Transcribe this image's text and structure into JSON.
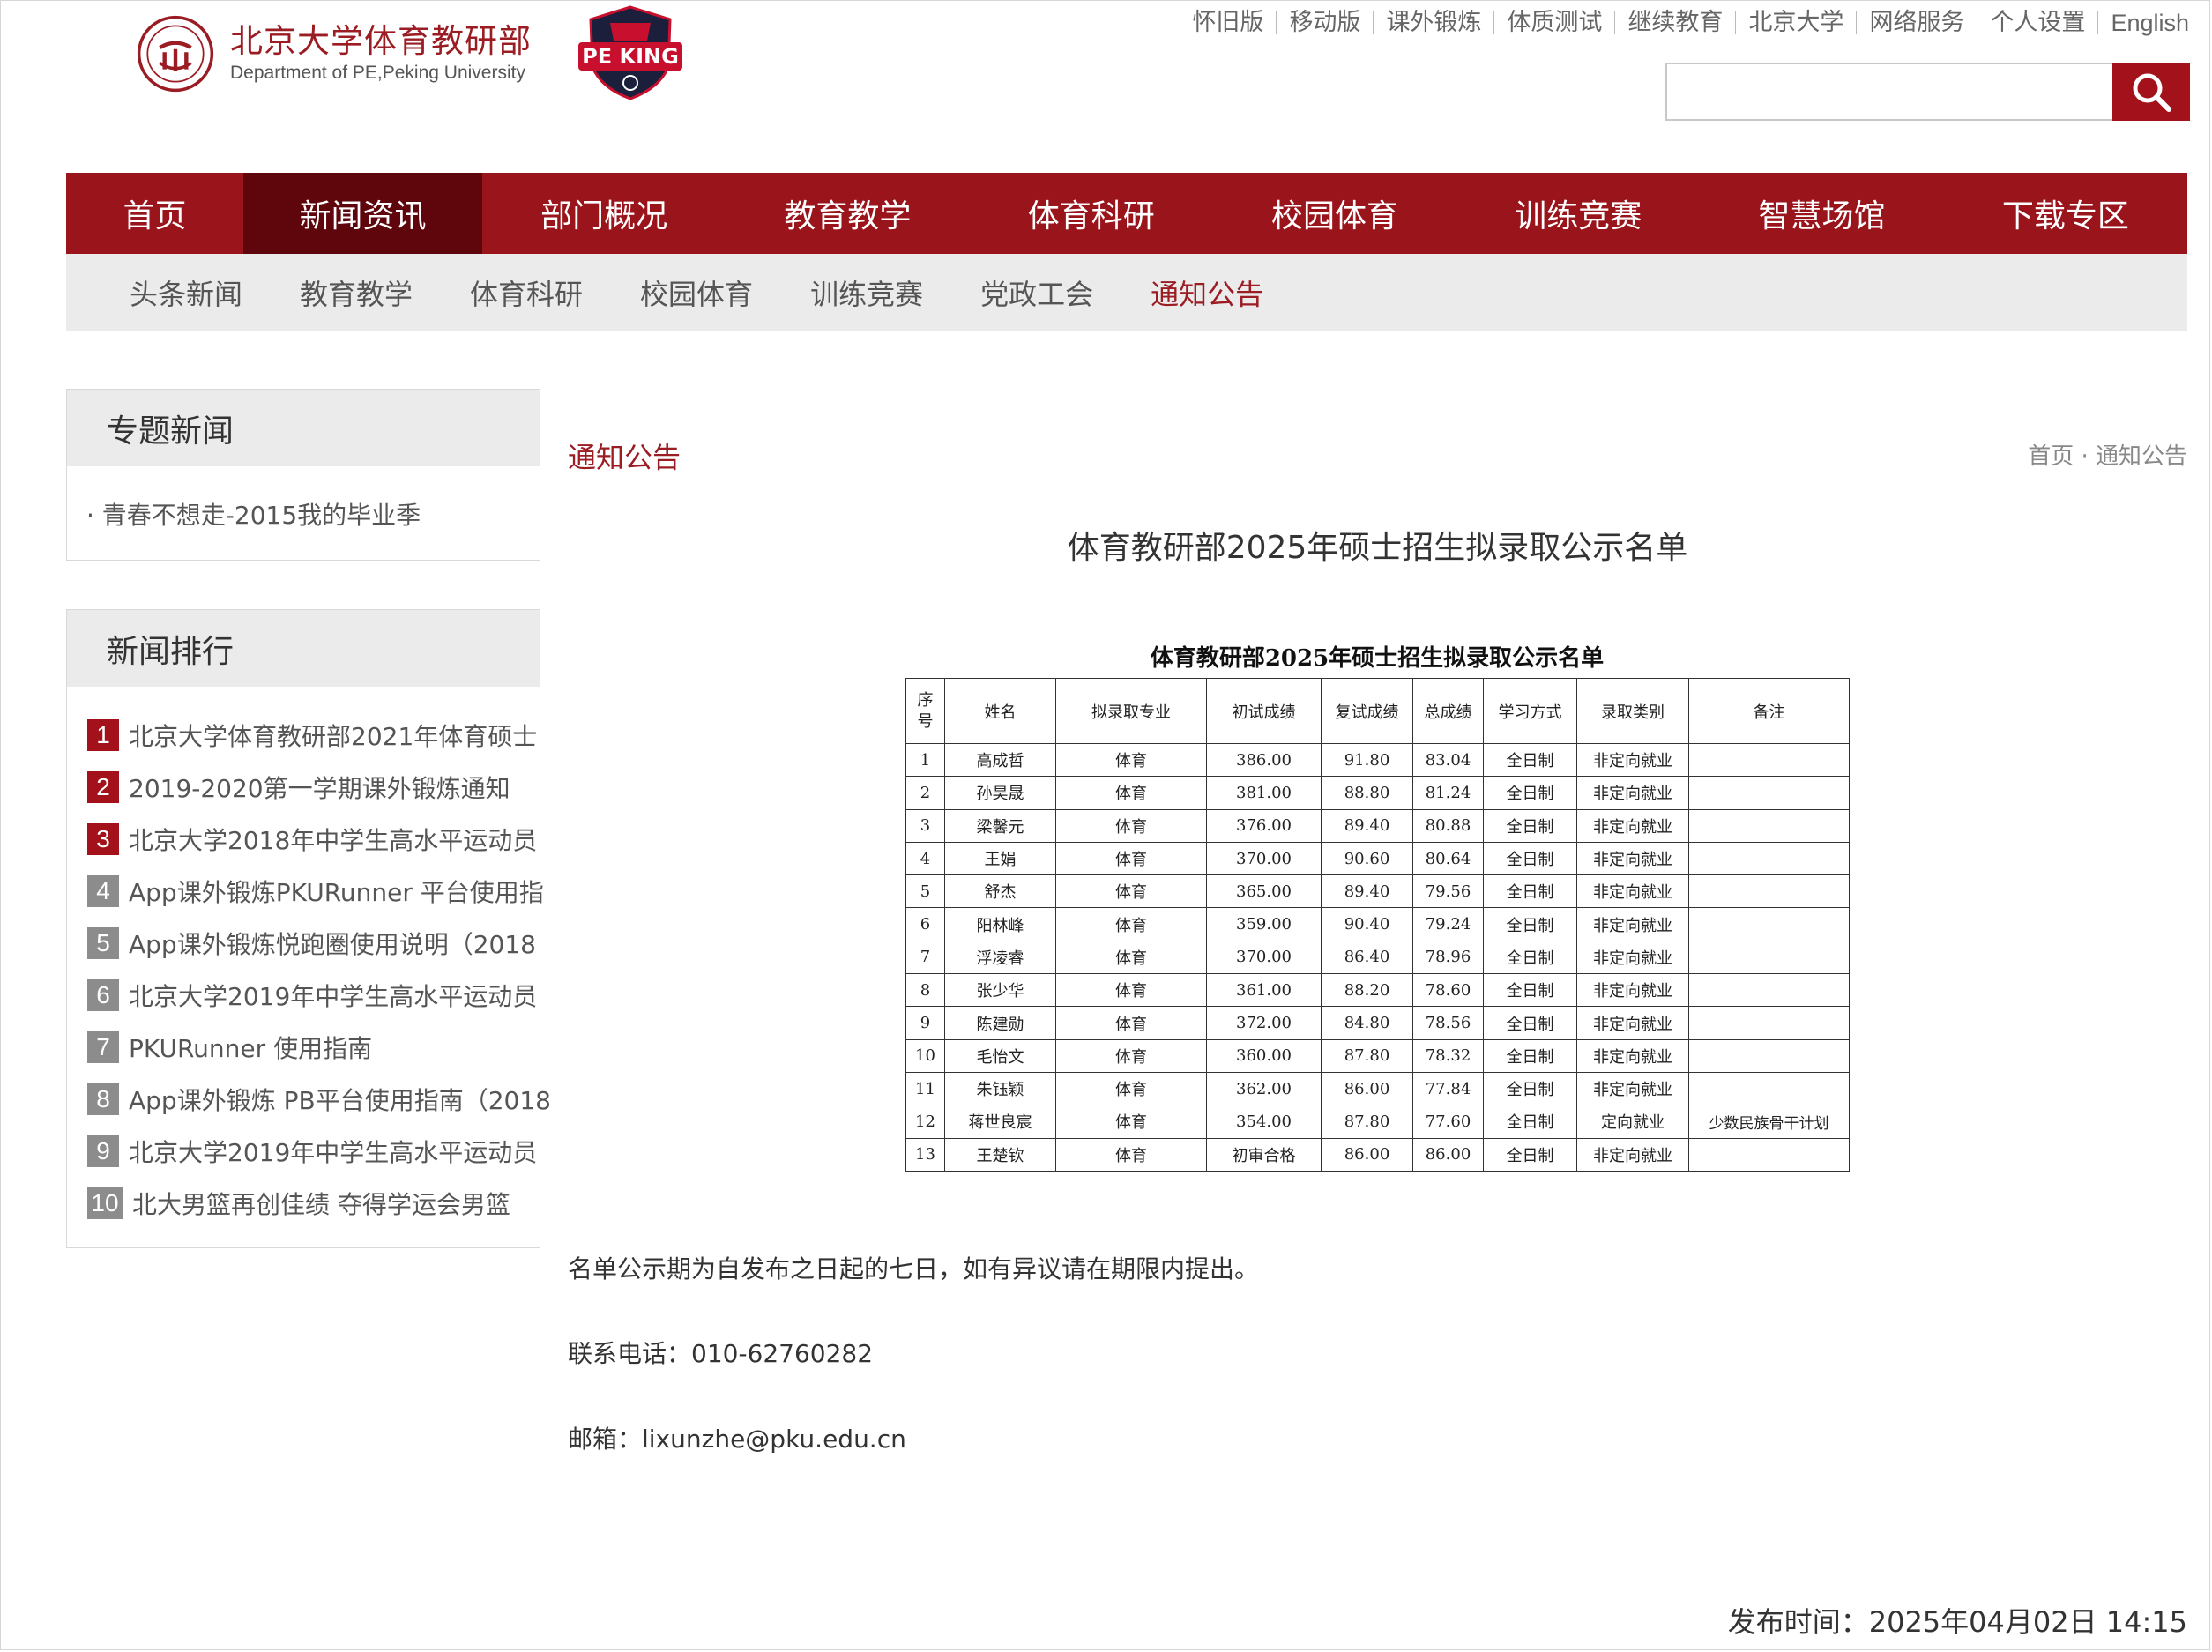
{
  "header": {
    "logo_cn": "北京大学体育教研部",
    "logo_en": "Department of PE,Peking University",
    "badge_text": "PE KING",
    "top_links": [
      "怀旧版",
      "移动版",
      "课外锻炼",
      "体质测试",
      "继续教育",
      "北京大学",
      "网络服务",
      "个人设置",
      "English"
    ],
    "search_placeholder": ""
  },
  "nav": {
    "items": [
      "首页",
      "新闻资讯",
      "部门概况",
      "教育教学",
      "体育科研",
      "校园体育",
      "训练竞赛",
      "智慧场馆",
      "下载专区"
    ],
    "active": "新闻资讯"
  },
  "subnav": {
    "items": [
      "头条新闻",
      "教育教学",
      "体育科研",
      "校园体育",
      "训练竞赛",
      "党政工会",
      "通知公告"
    ],
    "active": "通知公告"
  },
  "sidebar": {
    "special": {
      "title": "专题新闻",
      "item": "· 青春不想走-2015我的毕业季"
    },
    "ranking": {
      "title": "新闻排行",
      "items": [
        {
          "num": "1",
          "text": "北京大学体育教研部2021年体育硕士"
        },
        {
          "num": "2",
          "text": "2019-2020第一学期课外锻炼通知"
        },
        {
          "num": "3",
          "text": "北京大学2018年中学生高水平运动员"
        },
        {
          "num": "4",
          "text": "App课外锻炼PKURunner 平台使用指"
        },
        {
          "num": "5",
          "text": "App课外锻炼悦跑圈使用说明（2018"
        },
        {
          "num": "6",
          "text": "北京大学2019年中学生高水平运动员"
        },
        {
          "num": "7",
          "text": "PKURunner 使用指南"
        },
        {
          "num": "8",
          "text": "App课外锻炼 PB平台使用指南（2018"
        },
        {
          "num": "9",
          "text": "北京大学2019年中学生高水平运动员"
        },
        {
          "num": "10",
          "text": "北大男篮再创佳绩 夺得学运会男篮"
        }
      ]
    }
  },
  "content": {
    "section_title": "通知公告",
    "breadcrumb": "首页 · 通知公告",
    "article_title": "体育教研部2025年硕士招生拟录取公示名单",
    "table_title": "体育教研部2025年硕士招生拟录取公示名单",
    "columns": [
      "序号",
      "姓名",
      "拟录取专业",
      "初试成绩",
      "复试成绩",
      "总成绩",
      "学习方式",
      "录取类别",
      "备注"
    ],
    "rows": [
      [
        "1",
        "高成哲",
        "体育",
        "386.00",
        "91.80",
        "83.04",
        "全日制",
        "非定向就业",
        ""
      ],
      [
        "2",
        "孙昊晟",
        "体育",
        "381.00",
        "88.80",
        "81.24",
        "全日制",
        "非定向就业",
        ""
      ],
      [
        "3",
        "梁馨元",
        "体育",
        "376.00",
        "89.40",
        "80.88",
        "全日制",
        "非定向就业",
        ""
      ],
      [
        "4",
        "王娟",
        "体育",
        "370.00",
        "90.60",
        "80.64",
        "全日制",
        "非定向就业",
        ""
      ],
      [
        "5",
        "舒杰",
        "体育",
        "365.00",
        "89.40",
        "79.56",
        "全日制",
        "非定向就业",
        ""
      ],
      [
        "6",
        "阳林峰",
        "体育",
        "359.00",
        "90.40",
        "79.24",
        "全日制",
        "非定向就业",
        ""
      ],
      [
        "7",
        "浮凌睿",
        "体育",
        "370.00",
        "86.40",
        "78.96",
        "全日制",
        "非定向就业",
        ""
      ],
      [
        "8",
        "张少华",
        "体育",
        "361.00",
        "88.20",
        "78.60",
        "全日制",
        "非定向就业",
        ""
      ],
      [
        "9",
        "陈建勋",
        "体育",
        "372.00",
        "84.80",
        "78.56",
        "全日制",
        "非定向就业",
        ""
      ],
      [
        "10",
        "毛怡文",
        "体育",
        "360.00",
        "87.80",
        "78.32",
        "全日制",
        "非定向就业",
        ""
      ],
      [
        "11",
        "朱钰颖",
        "体育",
        "362.00",
        "86.00",
        "77.84",
        "全日制",
        "非定向就业",
        ""
      ],
      [
        "12",
        "蒋世良宸",
        "体育",
        "354.00",
        "87.80",
        "77.60",
        "全日制",
        "定向就业",
        "少数民族骨干计划"
      ],
      [
        "13",
        "王楚钦",
        "体育",
        "初审合格",
        "86.00",
        "86.00",
        "全日制",
        "非定向就业",
        ""
      ]
    ],
    "notice": "名单公示期为自发布之日起的七日，如有异议请在期限内提出。",
    "phone": "联系电话：010-62760282",
    "email": "邮箱：lixunzhe@pku.edu.cn",
    "publish_time": "发布时间：2025年04月02日 14:15"
  },
  "colors": {
    "brand": "#9a141c",
    "brand_dark": "#5e060b",
    "rank_red": "#a3121a",
    "rank_gray": "#8c8c8c"
  }
}
